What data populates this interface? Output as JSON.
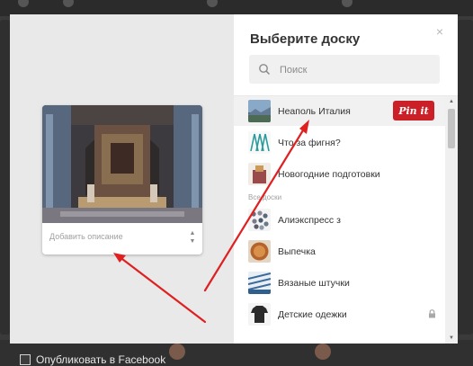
{
  "modal": {
    "title": "Выберите доску",
    "close_label": "×",
    "search": {
      "placeholder": "Поиск",
      "value": ""
    },
    "pin_preview": {
      "description_placeholder": "Добавить описание"
    },
    "boards_top": [
      {
        "name": "Неаполь Италия",
        "selected": true,
        "thumb": "naples-photo"
      },
      {
        "name": "Что за фигня?",
        "thumb": "teal-chairs"
      },
      {
        "name": "Новогодние подготовки",
        "thumb": "festive-bag"
      }
    ],
    "all_boards_label": "Все доски",
    "boards_all": [
      {
        "name": "Алиэкспресс з",
        "thumb": "beads"
      },
      {
        "name": "Выпечка",
        "thumb": "pie"
      },
      {
        "name": "Вязаные штучки",
        "thumb": "knit-pattern"
      },
      {
        "name": "Детские одежки",
        "thumb": "kids-clothes",
        "secret": true
      }
    ],
    "pin_button_label": "Pin it"
  },
  "facebook": {
    "label": "Опубликовать в Facebook",
    "checked": false
  },
  "colors": {
    "pin_red": "#cb2027",
    "arrow_red": "#e02020"
  }
}
